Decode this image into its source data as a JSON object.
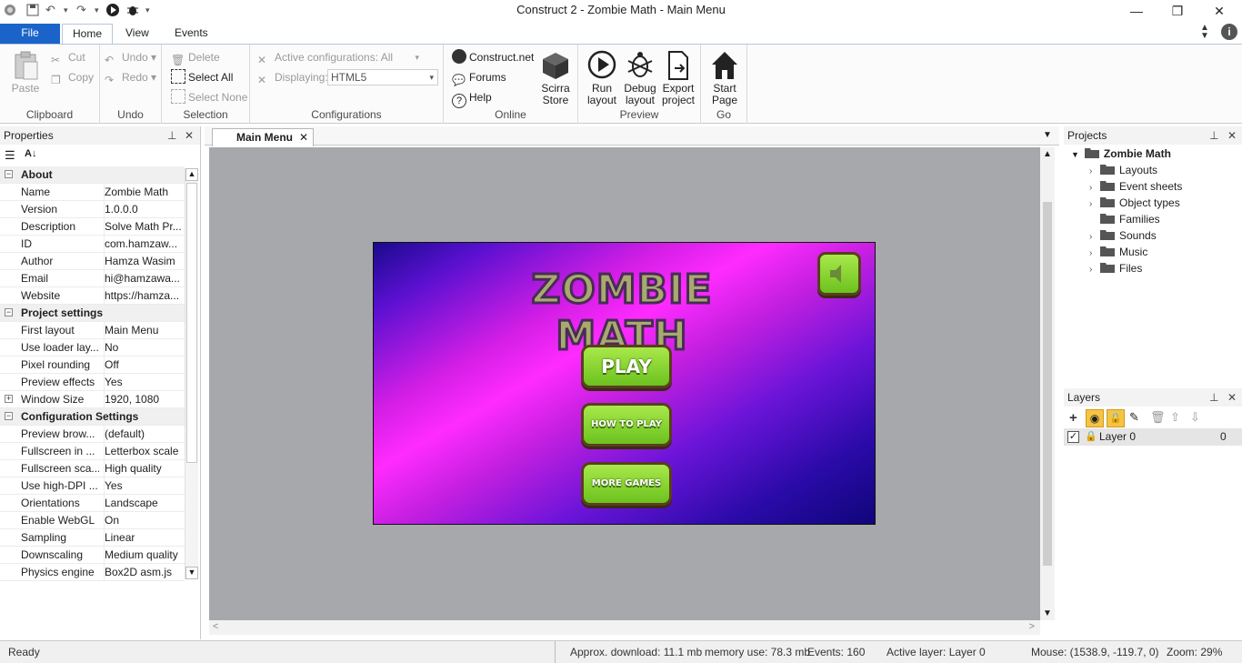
{
  "window": {
    "title": "Construct 2 - Zombie Math - Main Menu",
    "minimize": "—",
    "restore": "❐",
    "close": "✕"
  },
  "ribbon": {
    "tabs": [
      "File",
      "Home",
      "View",
      "Events"
    ],
    "active_tab": "Home",
    "clipboard": {
      "paste": "Paste",
      "cut": "Cut",
      "copy": "Copy",
      "label": "Clipboard"
    },
    "undo": {
      "undo": "Undo",
      "redo": "Redo",
      "label": "Undo"
    },
    "selection": {
      "delete": "Delete",
      "select_all": "Select All",
      "select_none": "Select None",
      "label": "Selection"
    },
    "configurations": {
      "active": "Active configurations: All",
      "displaying": "Displaying:",
      "displaying_value": "HTML5",
      "label": "Configurations"
    },
    "online": {
      "construct_net": "Construct.net",
      "forums": "Forums",
      "help": "Help",
      "store_line1": "Scirra",
      "store_line2": "Store",
      "label": "Online"
    },
    "preview": {
      "run_line1": "Run",
      "run_line2": "layout",
      "debug_line1": "Debug",
      "debug_line2": "layout",
      "export_line1": "Export",
      "export_line2": "project",
      "label": "Preview"
    },
    "go": {
      "start_line1": "Start",
      "start_line2": "Page",
      "label": "Go"
    }
  },
  "properties": {
    "title": "Properties",
    "rows": [
      {
        "cat": true,
        "k": "About",
        "sign": "−"
      },
      {
        "k": "Name",
        "v": "Zombie Math"
      },
      {
        "k": "Version",
        "v": "1.0.0.0"
      },
      {
        "k": "Description",
        "v": "Solve Math Pr..."
      },
      {
        "k": "ID",
        "v": "com.hamzaw..."
      },
      {
        "k": "Author",
        "v": "Hamza Wasim"
      },
      {
        "k": "Email",
        "v": "hi@hamzawa..."
      },
      {
        "k": "Website",
        "v": "https://hamza..."
      },
      {
        "cat": true,
        "k": "Project settings",
        "sign": "−"
      },
      {
        "k": "First layout",
        "v": "Main Menu"
      },
      {
        "k": "Use loader lay...",
        "v": "No"
      },
      {
        "k": "Pixel rounding",
        "v": "Off"
      },
      {
        "k": "Preview effects",
        "v": "Yes"
      },
      {
        "k": "Window Size",
        "v": "1920, 1080",
        "sign": "+"
      },
      {
        "cat": true,
        "k": "Configuration Settings",
        "sign": "−"
      },
      {
        "k": "Preview brow...",
        "v": "(default)"
      },
      {
        "k": "Fullscreen in ...",
        "v": "Letterbox scale"
      },
      {
        "k": "Fullscreen sca...",
        "v": "High quality"
      },
      {
        "k": "Use high-DPI ...",
        "v": "Yes"
      },
      {
        "k": "Orientations",
        "v": "Landscape"
      },
      {
        "k": "Enable WebGL",
        "v": "On"
      },
      {
        "k": "Sampling",
        "v": "Linear"
      },
      {
        "k": "Downscaling",
        "v": "Medium quality"
      },
      {
        "k": "Physics engine",
        "v": "Box2D asm.js"
      }
    ]
  },
  "document": {
    "tab": "Main Menu",
    "game": {
      "title": "ZOMBIE MATH",
      "play": "PLAY",
      "how_to_play": "HOW TO PLAY",
      "more_games": "MORE GAMES"
    }
  },
  "projects": {
    "title": "Projects",
    "root": "Zombie Math",
    "folders": [
      "Layouts",
      "Event sheets",
      "Object types",
      "Families",
      "Sounds",
      "Music",
      "Files"
    ]
  },
  "layers": {
    "title": "Layers",
    "items": [
      {
        "name": "Layer 0",
        "index": "0"
      }
    ]
  },
  "status": {
    "ready": "Ready",
    "download": "Approx. download: 11.1 mb",
    "memory": "memory use: 78.3 mb",
    "events": "Events: 160",
    "active_layer": "Active layer: Layer 0",
    "mouse": "Mouse: (1538.9, -119.7, 0)",
    "zoom": "Zoom: 29%"
  },
  "colors": {
    "file_tab": "#1a64c9",
    "canvas_bg": "#a7a8ab",
    "button_green": "#8fd63a"
  }
}
